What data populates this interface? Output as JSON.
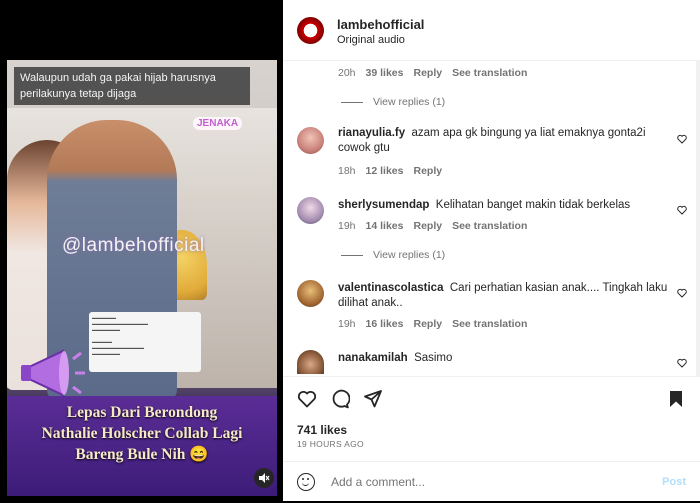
{
  "media": {
    "caption_top": "Walaupun udah ga pakai hijab harusnya perilakunya tetap dijaga",
    "watermark": "@lambehofficial",
    "badge": "JENAKA",
    "banner": [
      "Lepas Dari Berondong",
      "Nathalie Holscher Collab Lagi",
      "Bareng Bule Nih 😄"
    ],
    "mute_icon": "muted-speaker-icon"
  },
  "header": {
    "username": "lambehofficial",
    "subtitle": "Original audio"
  },
  "top_meta": {
    "time": "20h",
    "likes": "39 likes",
    "reply": "Reply",
    "translate": "See translation"
  },
  "view_replies_1": "View replies (1)",
  "comments": [
    {
      "user": "rianayulia.fy",
      "text": "azam apa gk bingung ya liat emaknya gonta2i cowok gtu",
      "time": "18h",
      "likes": "12 likes",
      "reply": "Reply",
      "translate": ""
    },
    {
      "user": "sherlysumendap",
      "text": "Kelihatan banget makin tidak berkelas",
      "time": "19h",
      "likes": "14 likes",
      "reply": "Reply",
      "translate": "See translation"
    },
    {
      "user": "valentinascolastica",
      "text": "Cari perhatian kasian anak.... Tingkah laku dilihat anak..",
      "time": "19h",
      "likes": "16 likes",
      "reply": "Reply",
      "translate": "See translation"
    },
    {
      "user": "nanakamilah",
      "text": "Sasimo"
    }
  ],
  "view_replies_2": "View replies (1)",
  "actions": {
    "likes": "741 likes",
    "time": "19 HOURS AGO",
    "add_comment_placeholder": "Add a comment...",
    "post": "Post"
  }
}
